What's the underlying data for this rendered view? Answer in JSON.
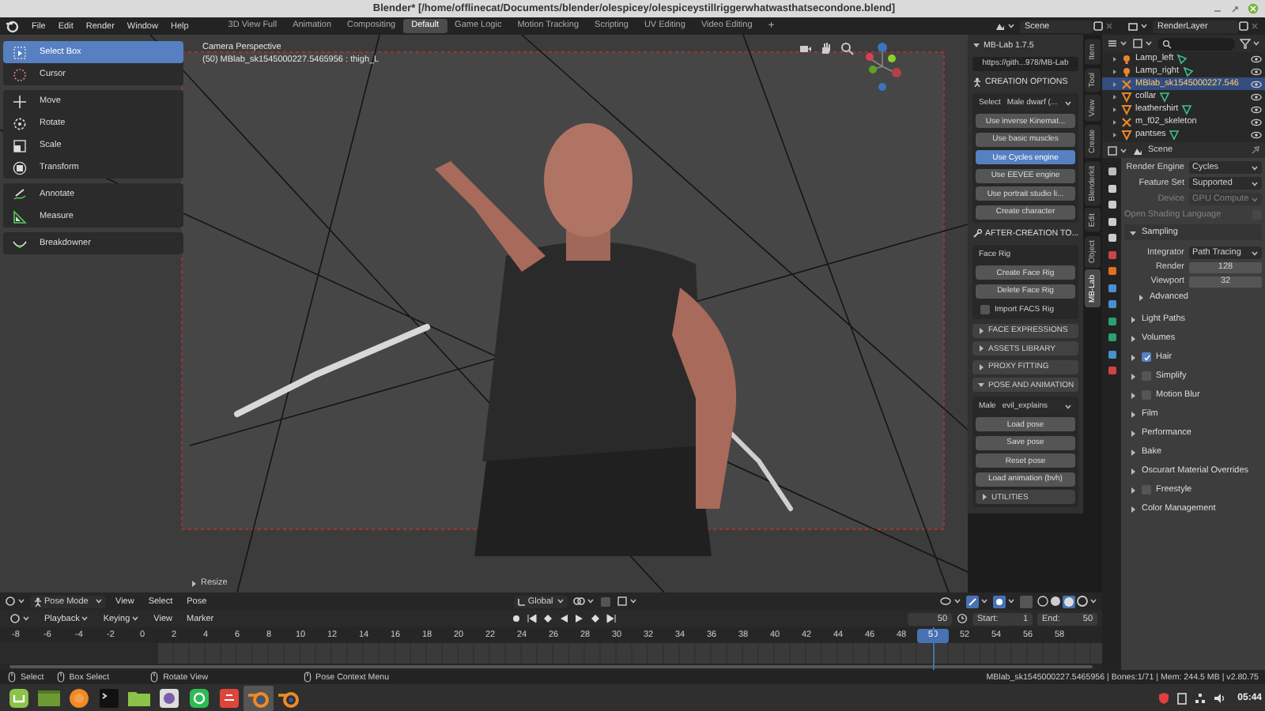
{
  "window": {
    "title": "Blender* [/home/offlinecat/Documents/blender/olespicey/olespiceystillriggerwhatwasthatsecondone.blend]"
  },
  "menu": [
    "File",
    "Edit",
    "Render",
    "Window",
    "Help"
  ],
  "workspaces": [
    {
      "label": "3D View Full",
      "selected": false
    },
    {
      "label": "Animation",
      "selected": false
    },
    {
      "label": "Compositing",
      "selected": false
    },
    {
      "label": "Default",
      "selected": true
    },
    {
      "label": "Game Logic",
      "selected": false
    },
    {
      "label": "Motion Tracking",
      "selected": false
    },
    {
      "label": "Scripting",
      "selected": false
    },
    {
      "label": "UV Editing",
      "selected": false
    },
    {
      "label": "Video Editing",
      "selected": false
    }
  ],
  "add_workspace": "+",
  "scene": "Scene",
  "view_layer": "RenderLayer",
  "tools": [
    [
      {
        "label": "Select Box",
        "selected": true
      },
      {
        "label": "Cursor",
        "selected": false
      }
    ],
    [
      {
        "label": "Move",
        "selected": false
      },
      {
        "label": "Rotate",
        "selected": false
      },
      {
        "label": "Scale",
        "selected": false
      },
      {
        "label": "Transform",
        "selected": false
      }
    ],
    [
      {
        "label": "Annotate",
        "selected": false
      },
      {
        "label": "Measure",
        "selected": false
      }
    ],
    [
      {
        "label": "Breakdowner",
        "selected": false
      }
    ]
  ],
  "viewport": {
    "camera": "Camera Perspective",
    "object": "(50) MBlab_sk1545000227.5465956 : thigh_L",
    "last_operator": "Resize"
  },
  "mblab": {
    "title": "MB-Lab 1.7.5",
    "items": [
      {
        "kind": "field",
        "value": "https://gith...978/MB-Lab"
      },
      {
        "kind": "heading",
        "label": "CREATION OPTIONS"
      },
      {
        "kind": "box",
        "items": [
          {
            "kind": "dropdown",
            "label": "Select",
            "value": "Male dwarf (..."
          },
          {
            "kind": "button",
            "label": "Use inverse Kinemat...",
            "selected": false
          },
          {
            "kind": "button",
            "label": "Use basic muscles",
            "selected": false
          },
          {
            "kind": "button",
            "label": "Use Cycles engine",
            "selected": true
          },
          {
            "kind": "button",
            "label": "Use EEVEE engine",
            "selected": false
          },
          {
            "kind": "button",
            "label": "Use portrait studio li...",
            "selected": false
          },
          {
            "kind": "button",
            "label": "Create character",
            "selected": false
          }
        ]
      },
      {
        "kind": "heading",
        "label": "AFTER-CREATION TO..."
      },
      {
        "kind": "box",
        "items": [
          {
            "kind": "label",
            "label": "Face Rig"
          },
          {
            "kind": "button",
            "label": "Create Face Rig",
            "selected": false
          },
          {
            "kind": "button",
            "label": "Delete Face Rig",
            "selected": false
          },
          {
            "kind": "checkbox",
            "label": "Import FACS Rig",
            "checked": false
          }
        ]
      },
      {
        "kind": "section",
        "label": "FACE EXPRESSIONS",
        "expanded": false
      },
      {
        "kind": "section",
        "label": "ASSETS LIBRARY",
        "expanded": false
      },
      {
        "kind": "section",
        "label": "PROXY FITTING",
        "expanded": false
      },
      {
        "kind": "section",
        "label": "POSE AND ANIMATION",
        "expanded": true
      },
      {
        "kind": "box",
        "items": [
          {
            "kind": "dropdown",
            "label": "Male",
            "value": "evil_explains"
          },
          {
            "kind": "button",
            "label": "Load pose",
            "selected": false
          },
          {
            "kind": "button",
            "label": "Save pose",
            "selected": false
          },
          {
            "kind": "button",
            "label": "Reset pose",
            "selected": false
          },
          {
            "kind": "button",
            "label": "Load animation (bvh)",
            "selected": false
          },
          {
            "kind": "section",
            "label": "UTILITIES",
            "expanded": false
          }
        ]
      }
    ]
  },
  "sidebar_tabs": [
    {
      "label": "Item",
      "selected": false
    },
    {
      "label": "Tool",
      "selected": false
    },
    {
      "label": "View",
      "selected": false
    },
    {
      "label": "Create",
      "selected": false
    },
    {
      "label": "Blenderkit",
      "selected": false
    },
    {
      "label": "Edit",
      "selected": false
    },
    {
      "label": "Object",
      "selected": false
    },
    {
      "label": "MB-Lab",
      "selected": true
    }
  ],
  "outliner": {
    "rows": [
      {
        "label": "Lamp_left",
        "kind": "light",
        "selected": false
      },
      {
        "label": "Lamp_right",
        "kind": "light",
        "selected": false
      },
      {
        "label": "MBlab_sk1545000227.546",
        "kind": "armature",
        "selected": true
      },
      {
        "label": "collar",
        "kind": "mesh",
        "selected": false
      },
      {
        "label": "leathershirt",
        "kind": "mesh",
        "selected": false
      },
      {
        "label": "m_f02_skeleton",
        "kind": "armature",
        "selected": false
      },
      {
        "label": "pantses",
        "kind": "mesh",
        "selected": false
      }
    ]
  },
  "properties": {
    "context": "Scene",
    "fields": [
      {
        "kind": "dropdown",
        "label": "Render Engine",
        "value": "Cycles",
        "disabled": false
      },
      {
        "kind": "dropdown",
        "label": "Feature Set",
        "value": "Supported",
        "disabled": false
      },
      {
        "kind": "dropdown",
        "label": "Device",
        "value": "GPU Compute",
        "disabled": true
      },
      {
        "kind": "checkbox",
        "label": "Open Shading Language",
        "checked": false,
        "disabled": true
      }
    ],
    "panels": [
      {
        "label": "Sampling",
        "expanded": true,
        "items": [
          {
            "kind": "dropdown",
            "label": "Integrator",
            "value": "Path Tracing"
          },
          {
            "kind": "number",
            "label": "Render",
            "value": "128"
          },
          {
            "kind": "number",
            "label": "Viewport",
            "value": "32"
          },
          {
            "kind": "subpanel",
            "label": "Advanced",
            "expanded": false
          }
        ]
      },
      {
        "label": "Light Paths",
        "expanded": false
      },
      {
        "label": "Volumes",
        "expanded": false
      },
      {
        "label": "Hair",
        "expanded": false,
        "checked": true
      },
      {
        "label": "Simplify",
        "expanded": false,
        "checked": false
      },
      {
        "label": "Motion Blur",
        "expanded": false,
        "checked": false
      },
      {
        "label": "Film",
        "expanded": false
      },
      {
        "label": "Performance",
        "expanded": false
      },
      {
        "label": "Bake",
        "expanded": false
      },
      {
        "label": "Oscurart Material Overrides",
        "expanded": false
      },
      {
        "label": "Freestyle",
        "expanded": false,
        "checked": false
      },
      {
        "label": "Color Management",
        "expanded": false
      }
    ]
  },
  "viewport_header": {
    "mode": "Pose Mode",
    "menus": [
      "View",
      "Select",
      "Pose"
    ],
    "orientation": "Global"
  },
  "timeline": {
    "menus": [
      {
        "label": "Playback",
        "dropdown": true
      },
      {
        "label": "Keying",
        "dropdown": true
      },
      {
        "label": "View",
        "dropdown": false
      },
      {
        "label": "Marker",
        "dropdown": false
      }
    ],
    "current_frame": "50",
    "start_label": "Start:",
    "start": "1",
    "end_label": "End:",
    "end": "50",
    "ruler": [
      {
        "label": "-8",
        "selected": false
      },
      {
        "label": "-6",
        "selected": false
      },
      {
        "label": "-4",
        "selected": false
      },
      {
        "label": "-2",
        "selected": false
      },
      {
        "label": "0",
        "selected": false
      },
      {
        "label": "2",
        "selected": false
      },
      {
        "label": "4",
        "selected": false
      },
      {
        "label": "6",
        "selected": false
      },
      {
        "label": "8",
        "selected": false
      },
      {
        "label": "10",
        "selected": false
      },
      {
        "label": "12",
        "selected": false
      },
      {
        "label": "14",
        "selected": false
      },
      {
        "label": "16",
        "selected": false
      },
      {
        "label": "18",
        "selected": false
      },
      {
        "label": "20",
        "selected": false
      },
      {
        "label": "22",
        "selected": false
      },
      {
        "label": "24",
        "selected": false
      },
      {
        "label": "26",
        "selected": false
      },
      {
        "label": "28",
        "selected": false
      },
      {
        "label": "30",
        "selected": false
      },
      {
        "label": "32",
        "selected": false
      },
      {
        "label": "34",
        "selected": false
      },
      {
        "label": "36",
        "selected": false
      },
      {
        "label": "38",
        "selected": false
      },
      {
        "label": "40",
        "selected": false
      },
      {
        "label": "42",
        "selected": false
      },
      {
        "label": "44",
        "selected": false
      },
      {
        "label": "46",
        "selected": false
      },
      {
        "label": "48",
        "selected": false
      },
      {
        "label": "50",
        "selected": true
      },
      {
        "label": "52",
        "selected": false
      },
      {
        "label": "54",
        "selected": false
      },
      {
        "label": "56",
        "selected": false
      },
      {
        "label": "58",
        "selected": false
      }
    ]
  },
  "status_bar": {
    "hints": [
      "Select",
      "Box Select",
      "Rotate View",
      "Pose Context Menu"
    ],
    "info": "MBlab_sk1545000227.5465956 | Bones:1/71 | Mem: 244.5 MB | v2.80.75"
  },
  "taskbar": {
    "apps": [
      {
        "kind": "menu",
        "selected": false
      },
      {
        "kind": "window",
        "selected": false
      },
      {
        "kind": "browser",
        "selected": false
      },
      {
        "kind": "terminal",
        "selected": false
      },
      {
        "kind": "folder",
        "selected": false
      },
      {
        "kind": "viewer",
        "selected": false
      },
      {
        "kind": "store",
        "selected": false
      },
      {
        "kind": "toolbox",
        "selected": false
      },
      {
        "kind": "blender",
        "selected": true
      },
      {
        "kind": "blender",
        "selected": false
      }
    ],
    "clock": "05:44"
  }
}
